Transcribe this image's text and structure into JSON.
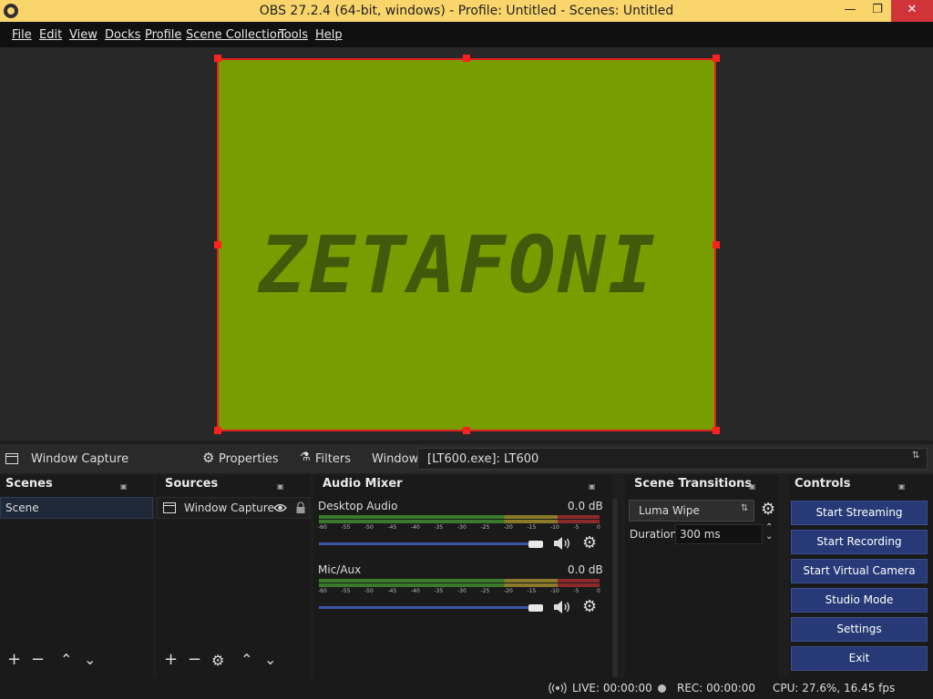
{
  "window": {
    "title": "OBS 27.2.4 (64-bit, windows) - Profile: Untitled - Scenes: Untitled",
    "minimize": "—",
    "restore": "❐",
    "close": "✕"
  },
  "menu": [
    "File",
    "Edit",
    "View",
    "Docks",
    "Profile",
    "Scene Collection",
    "Tools",
    "Help"
  ],
  "preview": {
    "captured_text": "ZETAFONI",
    "background_color": "#779d00"
  },
  "source_toolbar": {
    "selected_source": "Window Capture",
    "properties": "Properties",
    "filters": "Filters",
    "window_label": "Window",
    "window_value": "[LT600.exe]: LT600"
  },
  "scenes": {
    "title": "Scenes",
    "items": [
      "Scene"
    ]
  },
  "sources": {
    "title": "Sources",
    "items": [
      "Window Capture"
    ]
  },
  "audio_mixer": {
    "title": "Audio Mixer",
    "ticks": [
      "-60",
      "-55",
      "-50",
      "-45",
      "-40",
      "-35",
      "-30",
      "-25",
      "-20",
      "-15",
      "-10",
      "-5",
      "0"
    ],
    "channels": [
      {
        "name": "Desktop Audio",
        "db": "0.0 dB",
        "volume": 1.0
      },
      {
        "name": "Mic/Aux",
        "db": "0.0 dB",
        "volume": 1.0
      }
    ]
  },
  "transitions": {
    "title": "Scene Transitions",
    "selected": "Luma Wipe",
    "duration_label": "Duration",
    "duration_value": "300 ms"
  },
  "controls": {
    "title": "Controls",
    "buttons": [
      "Start Streaming",
      "Start Recording",
      "Start Virtual Camera",
      "Studio Mode",
      "Settings",
      "Exit"
    ]
  },
  "status": {
    "live": "LIVE: 00:00:00",
    "rec": "REC: 00:00:00",
    "cpu": "CPU: 27.6%, 16.45 fps"
  }
}
